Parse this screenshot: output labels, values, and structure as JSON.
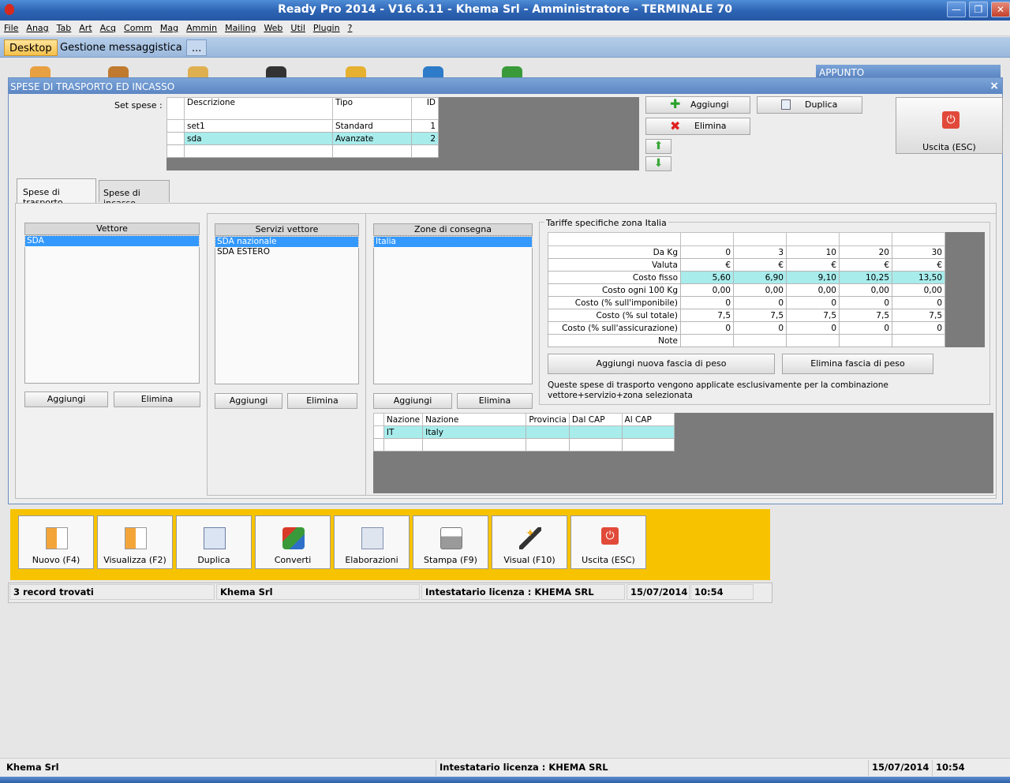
{
  "window": {
    "title": "Ready Pro 2014 - V16.6.11 - Khema Srl - Amministratore - TERMINALE 70",
    "min_label": "—",
    "restore_label": "❐",
    "close_label": "✕"
  },
  "menu": [
    "File",
    "Anag",
    "Tab",
    "Art",
    "Acq",
    "Comm",
    "Mag",
    "Ammin",
    "Mailing",
    "Web",
    "Util",
    "Plugin",
    "?"
  ],
  "tabs": {
    "desktop": "Desktop",
    "messaggistica": "Gestione messaggistica",
    "more": "..."
  },
  "appunto_label": "APPUNTO",
  "dialog": {
    "title": "SPESE DI TRASPORTO ED INCASSO",
    "close": "×",
    "set_label": "Set spese :",
    "set_headers": {
      "descrizione": "Descrizione",
      "tipo": "Tipo",
      "id": "ID"
    },
    "set_rows": [
      {
        "descrizione": "set1",
        "tipo": "Standard",
        "id": "1"
      },
      {
        "descrizione": "sda",
        "tipo": "Avanzate",
        "id": "2"
      }
    ],
    "btn_aggiungi": "Aggiungi",
    "btn_duplica": "Duplica",
    "btn_elimina": "Elimina",
    "btn_uscita": "Uscita (ESC)",
    "tab_trasporto": "Spese di trasporto",
    "tab_incasso": "Spese di incasso",
    "vettore_header": "Vettore",
    "vettore_items": [
      "SDA"
    ],
    "servizi_header": "Servizi vettore",
    "servizi_items": [
      "SDA nazionale",
      "SDA ESTERO"
    ],
    "zone_header": "Zone di consegna",
    "zone_items": [
      "Italia"
    ],
    "btn_add": "Aggiungi",
    "btn_del": "Elimina",
    "zone_table_headers": {
      "nazione_code": "Nazione",
      "nazione": "Nazione",
      "provincia": "Provincia",
      "dal_cap": "Dal CAP",
      "al_cap": "Al CAP"
    },
    "zone_table_row": {
      "code": "IT",
      "nazione": "Italy"
    },
    "tariffe_title": "Tariffe specifiche zona Italia",
    "tariffe_rows": [
      {
        "label": "Da Kg",
        "values": [
          "0",
          "3",
          "10",
          "20",
          "30"
        ]
      },
      {
        "label": "Valuta",
        "values": [
          "€",
          "€",
          "€",
          "€",
          "€"
        ]
      },
      {
        "label": "Costo fisso",
        "values": [
          "5,60",
          "6,90",
          "9,10",
          "10,25",
          "13,50"
        ]
      },
      {
        "label": "Costo ogni 100 Kg",
        "values": [
          "0,00",
          "0,00",
          "0,00",
          "0,00",
          "0,00"
        ]
      },
      {
        "label": "Costo (% sull'imponibile)",
        "values": [
          "0",
          "0",
          "0",
          "0",
          "0"
        ]
      },
      {
        "label": "Costo (% sul totale)",
        "values": [
          "7,5",
          "7,5",
          "7,5",
          "7,5",
          "7,5"
        ]
      },
      {
        "label": "Costo (% sull'assicurazione)",
        "values": [
          "0",
          "0",
          "0",
          "0",
          "0"
        ]
      },
      {
        "label": "Note",
        "values": [
          "",
          "",
          "",
          "",
          ""
        ]
      }
    ],
    "btn_add_fascia": "Aggiungi nuova fascia di peso",
    "btn_del_fascia": "Elimina fascia di peso",
    "note_text": "Queste spese di trasporto vengono applicate esclusivamente per la combinazione vettore+servizio+zona selezionata"
  },
  "toolbar": [
    "Nuovo (F4)",
    "Visualizza (F2)",
    "Duplica",
    "Converti",
    "Elaborazioni",
    "Stampa (F9)",
    "Visual (F10)",
    "Uscita (ESC)"
  ],
  "inner_status": {
    "records": "3 record trovati",
    "company": "Khema Srl",
    "license": "Intestatario licenza : KHEMA SRL",
    "date": "15/07/2014",
    "time": "10:54"
  },
  "bottom_status": {
    "company": "Khema Srl",
    "license": "Intestatario licenza : KHEMA SRL",
    "date": "15/07/2014",
    "time": "10:54"
  }
}
